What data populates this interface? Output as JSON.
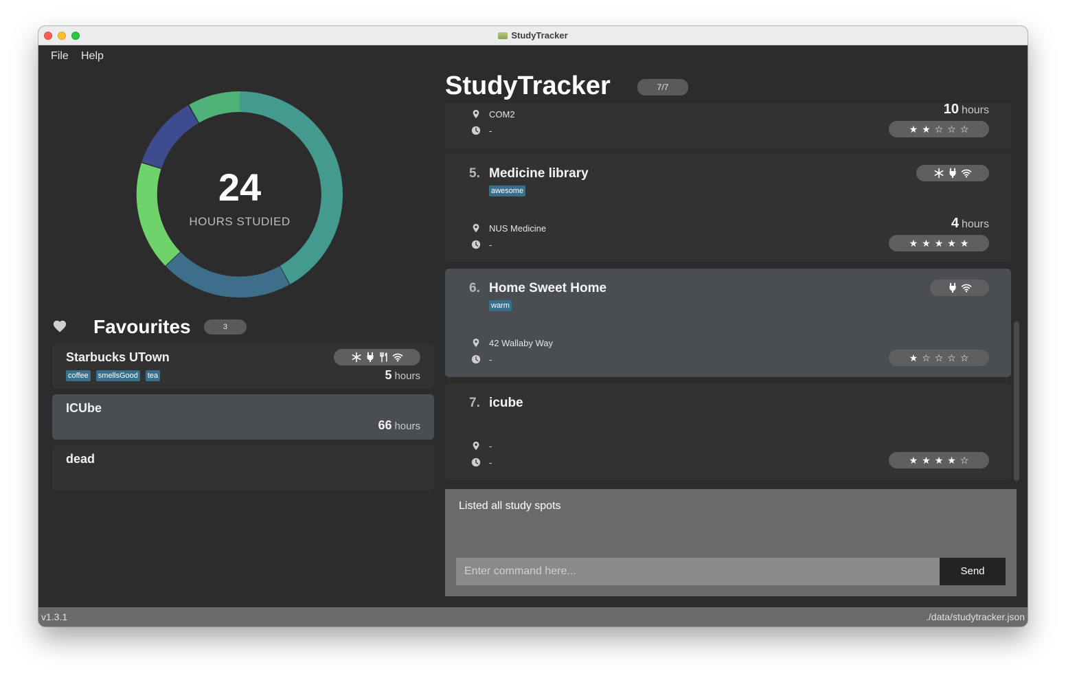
{
  "window": {
    "title": "StudyTracker"
  },
  "menu": {
    "file": "File",
    "help": "Help"
  },
  "summary": {
    "hours": "24",
    "label": "HOURS STUDIED",
    "segment_colors": [
      "#449a8f",
      "#3d6f8a",
      "#6fd36b",
      "#3d4b8f",
      "#4fb279"
    ]
  },
  "favourites": {
    "title": "Favourites",
    "count": "3",
    "items": [
      {
        "name": "Starbucks UTown",
        "hours": "5",
        "unit": "hours",
        "tags": [
          "coffee",
          "smellsGood",
          "tea"
        ],
        "amenities": [
          "snowflake-icon",
          "plug-icon",
          "food-icon",
          "wifi-icon"
        ]
      },
      {
        "name": "ICUbe",
        "hours": "66",
        "unit": "hours"
      },
      {
        "name": "dead"
      }
    ]
  },
  "app": {
    "title": "StudyTracker",
    "count": "7/7"
  },
  "spots": [
    {
      "index": "",
      "name": "",
      "location": "COM2",
      "hours_text": "-",
      "hours": "10",
      "unit": "hours",
      "rating": 2
    },
    {
      "index": "5.",
      "name": "Medicine library",
      "tags": [
        "awesome"
      ],
      "location": "NUS Medicine",
      "hours_text": "-",
      "hours": "4",
      "unit": "hours",
      "rating": 5,
      "amenities": [
        "snowflake-icon",
        "plug-icon",
        "wifi-icon"
      ]
    },
    {
      "index": "6.",
      "name": "Home Sweet Home",
      "tags": [
        "warm"
      ],
      "location": "42 Wallaby Way",
      "hours_text": "-",
      "rating": 1,
      "amenities": [
        "plug-icon",
        "wifi-icon"
      ]
    },
    {
      "index": "7.",
      "name": "icube",
      "location": "-",
      "hours_text": "-",
      "rating": 4
    }
  ],
  "result": {
    "text": "Listed all study spots"
  },
  "command": {
    "placeholder": "Enter command here...",
    "send": "Send"
  },
  "status": {
    "version": "v1.3.1",
    "path": "./data/studytracker.json"
  }
}
